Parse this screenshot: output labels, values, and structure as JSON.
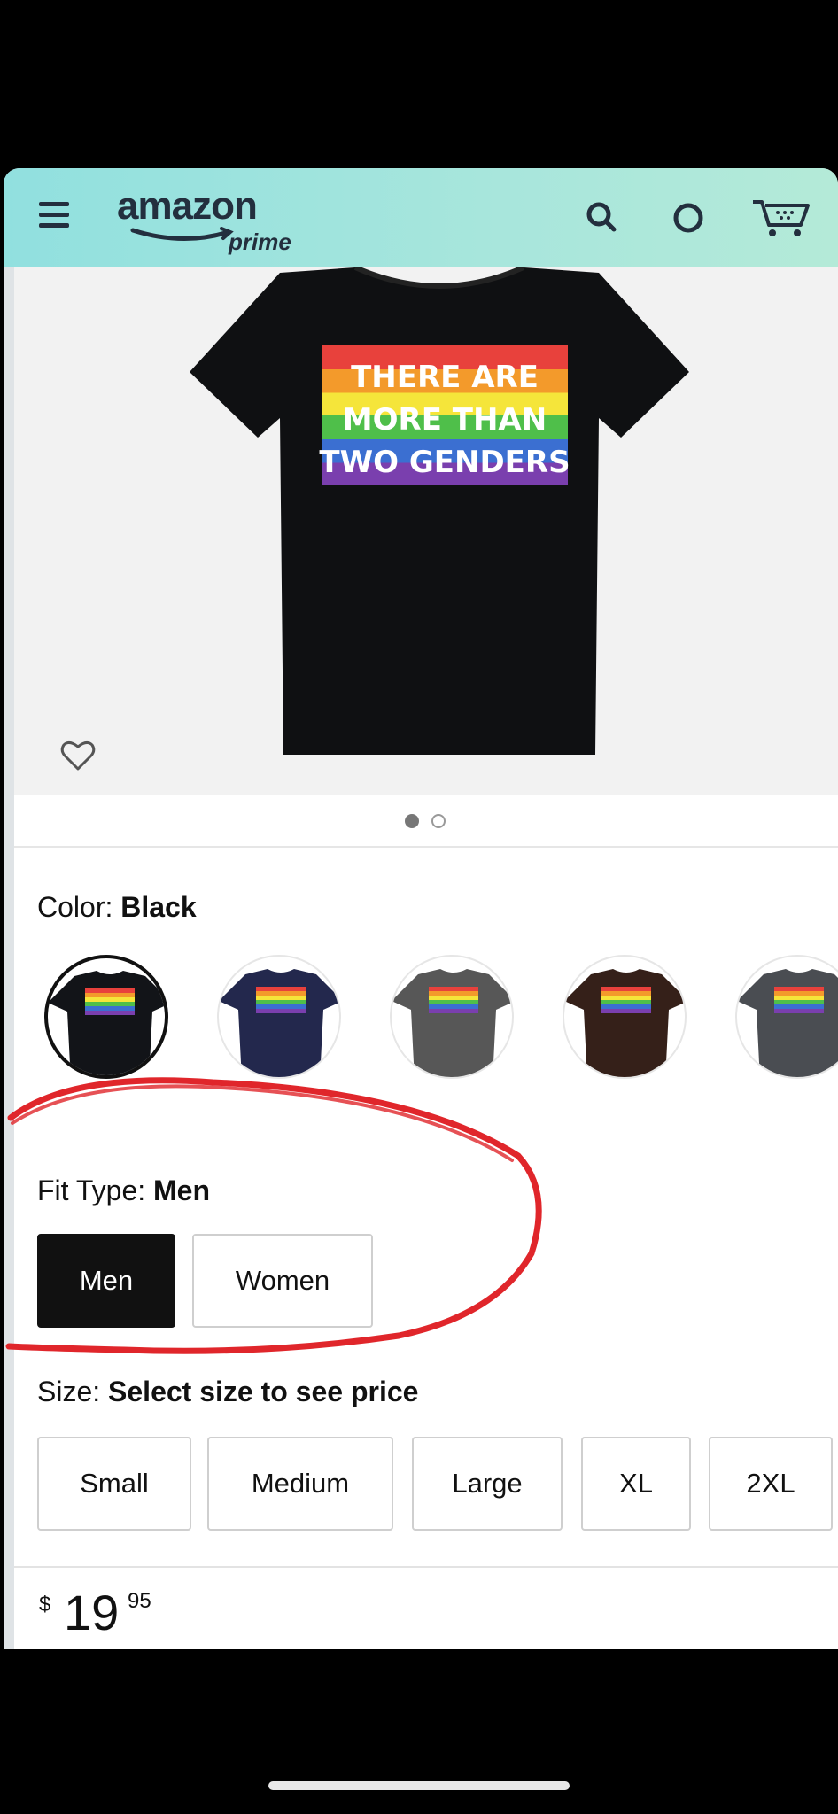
{
  "header": {
    "logo_text": "amazon",
    "logo_sub": "prime",
    "icons": [
      "menu-icon",
      "search-icon",
      "voice-icon",
      "cart-icon"
    ],
    "background": "#a6e5dc"
  },
  "product": {
    "shirt_text": [
      "THERE ARE",
      "MORE THAN",
      "TWO GENDERS"
    ],
    "image_dots": 2,
    "active_dot": 1
  },
  "color": {
    "label": "Color:",
    "value": "Black",
    "swatches": [
      {
        "name": "Black",
        "color": "#121418",
        "selected": true
      },
      {
        "name": "Navy",
        "color": "#23284d",
        "selected": false
      },
      {
        "name": "Gray",
        "color": "#575757",
        "selected": false
      },
      {
        "name": "Brown",
        "color": "#352019",
        "selected": false
      },
      {
        "name": "Dark Gray",
        "color": "#4a4d52",
        "selected": false
      }
    ]
  },
  "fit": {
    "label": "Fit Type:",
    "value": "Men",
    "options": [
      "Men",
      "Women"
    ],
    "selected": "Men"
  },
  "size": {
    "label": "Size:",
    "value": "Select size to see price",
    "options": [
      "Small",
      "Medium",
      "Large",
      "XL",
      "2XL"
    ]
  },
  "price": {
    "symbol": "$",
    "whole": "19",
    "fraction": "95"
  },
  "colors": {
    "annotation_red": "#e0262b",
    "active_button": "#111111"
  }
}
